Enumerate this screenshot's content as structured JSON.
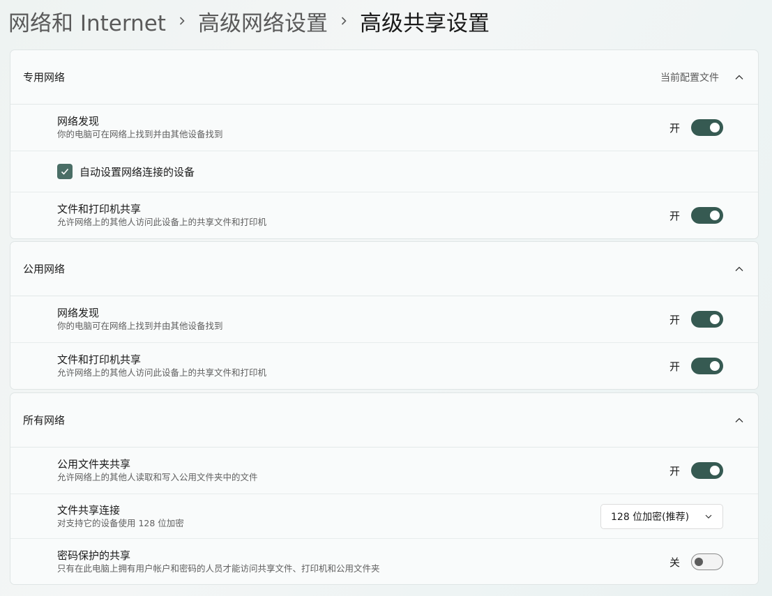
{
  "breadcrumb": {
    "items": [
      "网络和 Internet",
      "高级网络设置",
      "高级共享设置"
    ]
  },
  "private": {
    "title": "专用网络",
    "tag": "当前配置文件",
    "discovery": {
      "title": "网络发现",
      "desc": "你的电脑可在网络上找到并由其他设备找到",
      "state": "开",
      "on": true
    },
    "auto_setup": {
      "label": "自动设置网络连接的设备",
      "checked": true
    },
    "sharing": {
      "title": "文件和打印机共享",
      "desc": "允许网络上的其他人访问此设备上的共享文件和打印机",
      "state": "开",
      "on": true
    }
  },
  "public": {
    "title": "公用网络",
    "discovery": {
      "title": "网络发现",
      "desc": "你的电脑可在网络上找到并由其他设备找到",
      "state": "开",
      "on": true
    },
    "sharing": {
      "title": "文件和打印机共享",
      "desc": "允许网络上的其他人访问此设备上的共享文件和打印机",
      "state": "开",
      "on": true
    }
  },
  "all": {
    "title": "所有网络",
    "public_folder": {
      "title": "公用文件夹共享",
      "desc": "允许网络上的其他人读取和写入公用文件夹中的文件",
      "state": "开",
      "on": true
    },
    "file_sharing": {
      "title": "文件共享连接",
      "desc": "对支持它的设备使用 128 位加密",
      "value": "128 位加密(推荐)"
    },
    "password": {
      "title": "密码保护的共享",
      "desc": "只有在此电脑上拥有用户帐户和密码的人员才能访问共享文件、打印机和公用文件夹",
      "state": "关",
      "on": false
    }
  },
  "colors": {
    "accent": "#365a52",
    "checkbox": "#4a6e66"
  }
}
